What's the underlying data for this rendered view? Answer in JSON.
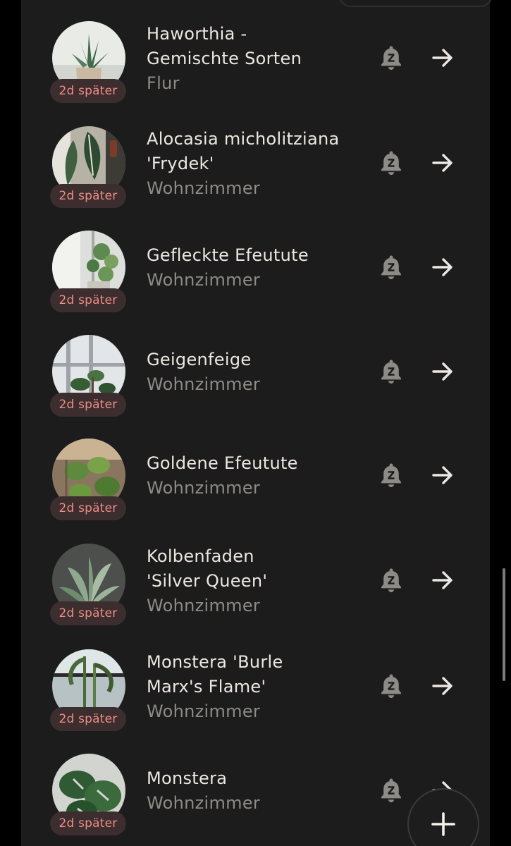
{
  "plants": [
    {
      "name_lines": [
        "Haworthia -",
        "Gemischte Sorten"
      ],
      "room": "Flur",
      "badge": "2d später",
      "photo": "haworthia-in-pot-photo"
    },
    {
      "name_lines": [
        "Alocasia micholitziana",
        "'Frydek'"
      ],
      "room": "Wohnzimmer",
      "badge": "2d später",
      "photo": "alocasia-photo"
    },
    {
      "name_lines": [
        "Gefleckte Efeutute"
      ],
      "room": "Wohnzimmer",
      "badge": "2d später",
      "photo": "variegated-pothos-photo"
    },
    {
      "name_lines": [
        "Geigenfeige"
      ],
      "room": "Wohnzimmer",
      "badge": "2d später",
      "photo": "fiddle-leaf-fig-photo"
    },
    {
      "name_lines": [
        "Goldene Efeutute"
      ],
      "room": "Wohnzimmer",
      "badge": "2d später",
      "photo": "golden-pothos-photo"
    },
    {
      "name_lines": [
        "Kolbenfaden",
        "'Silver Queen'"
      ],
      "room": "Wohnzimmer",
      "badge": "2d später",
      "photo": "aglaonema-photo"
    },
    {
      "name_lines": [
        "Monstera 'Burle",
        "Marx's Flame'"
      ],
      "room": "Wohnzimmer",
      "badge": "2d später",
      "photo": "monstera-burle-marx-photo"
    },
    {
      "name_lines": [
        "Monstera"
      ],
      "room": "Wohnzimmer",
      "badge": "2d später",
      "photo": "monstera-photo"
    }
  ],
  "icons": {
    "snooze": "snooze-bell-icon",
    "open": "arrow-right-icon",
    "add": "plus-icon"
  },
  "colors": {
    "background": "#1c1c1c",
    "badge_background": "#3c2e2e",
    "badge_text": "#ee8c86",
    "name_text": "#ece8e1",
    "room_text": "#8d8b86",
    "icon": "#ece8e1",
    "snooze_icon": "#8d8b86"
  }
}
